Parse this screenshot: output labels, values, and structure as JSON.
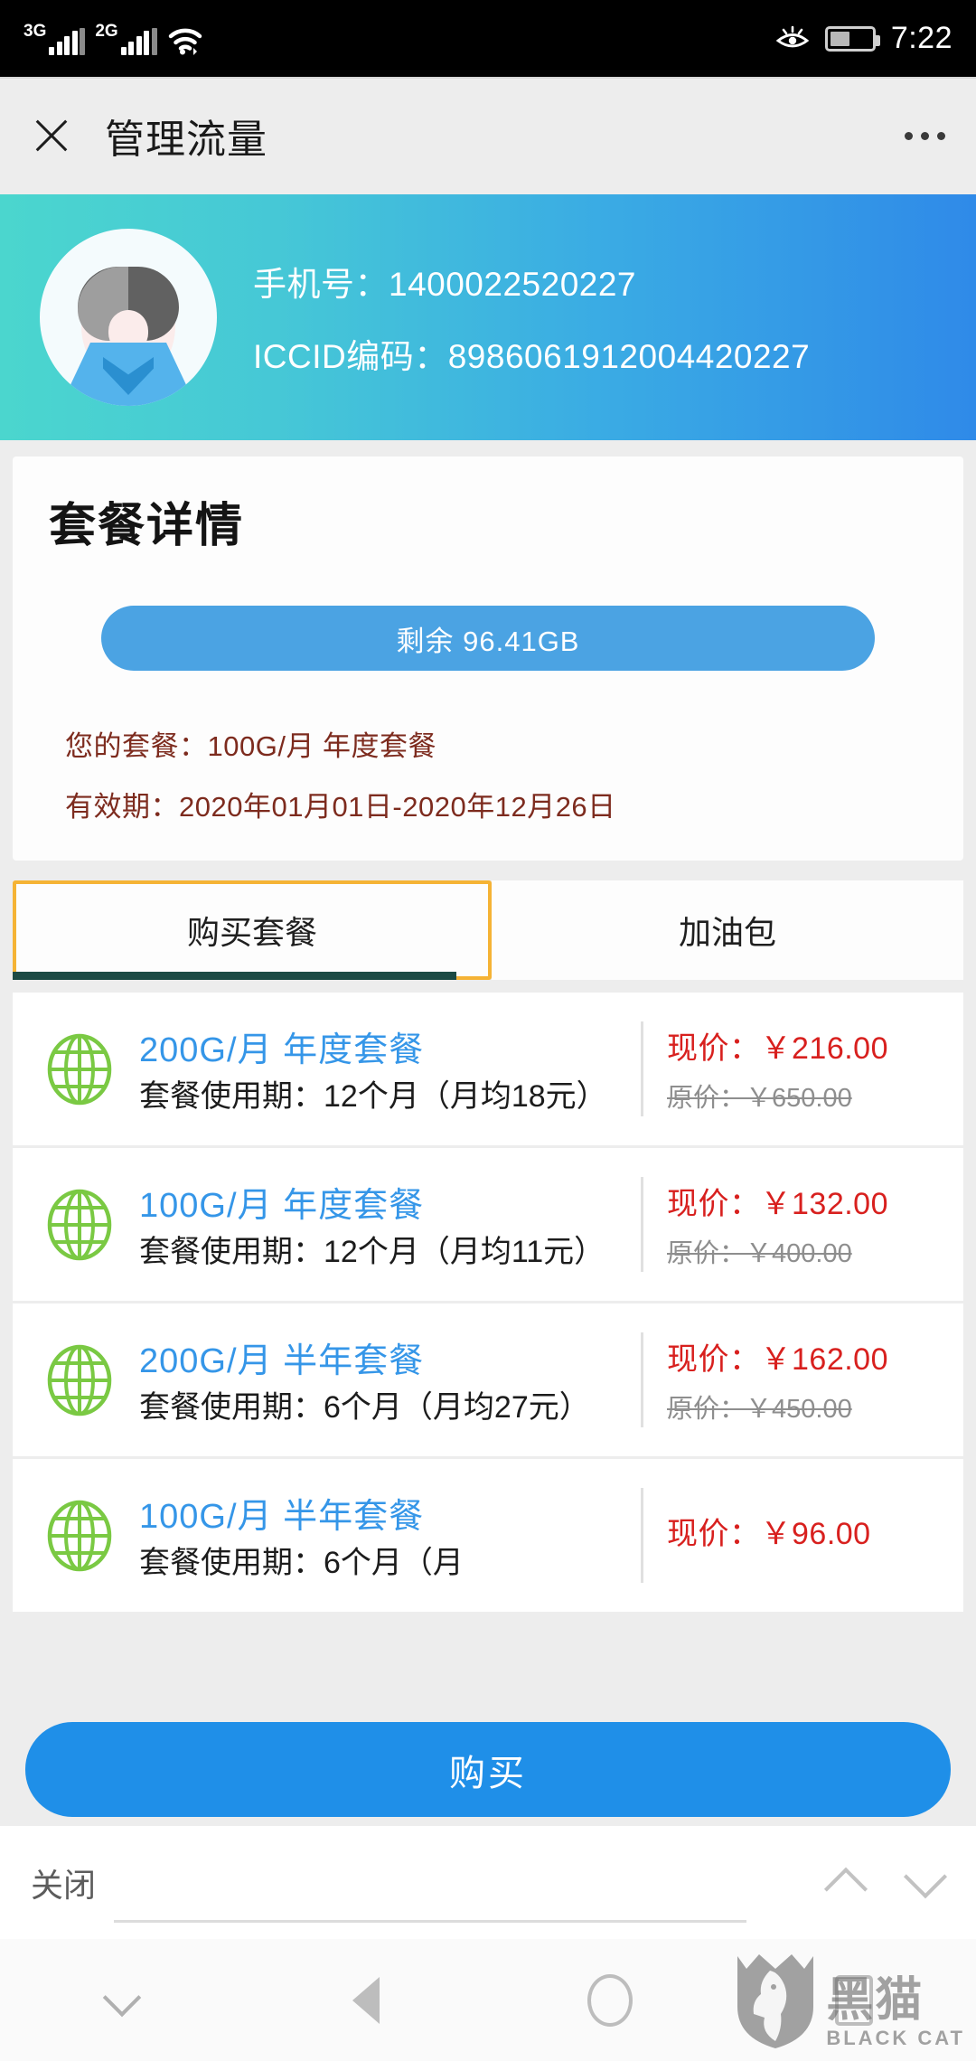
{
  "status_bar": {
    "network_1": "3G",
    "network_2": "2G",
    "wifi_icon": "wifi-icon",
    "eyecare_icon": "eye-care-icon",
    "battery_icon": "battery-icon",
    "time": "7:22"
  },
  "header": {
    "close_icon": "close-icon",
    "title": "管理流量",
    "more_icon": "more-options-icon"
  },
  "profile": {
    "avatar_icon": "user-avatar",
    "phone_label": "手机号：",
    "phone_value": "1400022520227",
    "iccid_label": "ICCID编码：",
    "iccid_value": "8986061912004420227"
  },
  "plan_card": {
    "title": "套餐详情",
    "remaining_badge": "剩余 96.41GB",
    "current_plan": "您的套餐：100G/月 年度套餐",
    "validity": "有效期：2020年01月01日-2020年12月26日"
  },
  "tabs": [
    {
      "label": "购买套餐",
      "active": true
    },
    {
      "label": "加油包",
      "active": false
    }
  ],
  "packages": [
    {
      "icon": "globe-icon",
      "name": "200G/月 年度套餐",
      "desc": "套餐使用期：12个月（月均18元）",
      "current_price": "现价：￥216.00",
      "original_price": "原价：￥650.00"
    },
    {
      "icon": "globe-icon",
      "name": "100G/月 年度套餐",
      "desc": "套餐使用期：12个月（月均11元）",
      "current_price": "现价：￥132.00",
      "original_price": "原价：￥400.00"
    },
    {
      "icon": "globe-icon",
      "name": "200G/月 半年套餐",
      "desc": "套餐使用期：6个月（月均27元）",
      "current_price": "现价：￥162.00",
      "original_price": "原价：￥450.00"
    },
    {
      "icon": "globe-icon",
      "name": "100G/月 半年套餐",
      "desc": "套餐使用期：6个月（月",
      "current_price": "现价：￥96.00",
      "original_price": ""
    }
  ],
  "buy_button": "购买",
  "keyboard_bar": {
    "close_label": "关闭",
    "up_icon": "chevron-up-icon",
    "down_icon": "chevron-down-icon"
  },
  "nav_bar": {
    "hide_keyboard_icon": "chevron-down-icon",
    "back_icon": "back-triangle-icon",
    "home_icon": "home-circle-icon",
    "recents_icon": "recents-square-icon"
  },
  "watermark": {
    "shield_icon": "black-cat-shield-logo",
    "cn": "黑猫",
    "en": "BLACK CAT"
  },
  "colors": {
    "accent_blue": "#1f8fe8",
    "badge_blue": "#4ba3e3",
    "banner_teal": "#4bd6ce",
    "banner_blue": "#2f8ae8",
    "price_red": "#d8201e",
    "plan_text": "#7d2b1e",
    "pkg_name_blue": "#3596e8",
    "tab_border": "#f5b335",
    "tab_underline": "#1c4a44",
    "globe_green": "#7ac943"
  }
}
